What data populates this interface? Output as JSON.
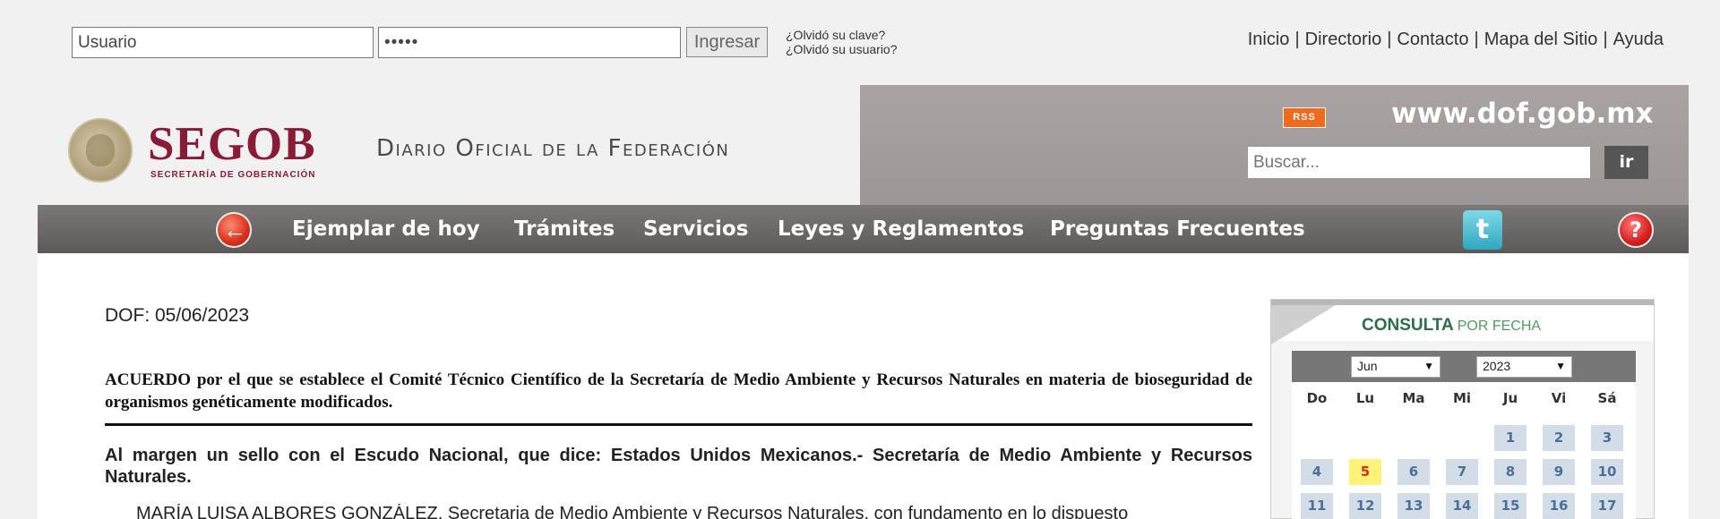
{
  "login": {
    "user_value": "Usuario",
    "password_value": "•••••",
    "submit_label": "Ingresar",
    "forgot_password": "¿Olvidó su clave?",
    "forgot_user": "¿Olvidó su usuario?"
  },
  "topnav": {
    "items": [
      "Inicio",
      "Directorio",
      "Contacto",
      "Mapa del Sitio",
      "Ayuda"
    ],
    "separator": "|"
  },
  "header": {
    "brand": "SEGOB",
    "brand_sub": "SECRETARÍA DE GOBERNACIÓN",
    "title": "Diario Oficial de la Federación",
    "rss_label": "RSS",
    "site_url": "www.dof.gob.mx",
    "search_placeholder": "Buscar...",
    "search_button": "ir"
  },
  "nav": {
    "items": [
      "Ejemplar de hoy",
      "Trámites",
      "Servicios",
      "Leyes y Reglamentos",
      "Preguntas Frecuentes"
    ],
    "back_glyph": "←",
    "twitter_glyph": "t",
    "help_glyph": "?"
  },
  "article": {
    "dof_date": "DOF: 05/06/2023",
    "acuerdo": "ACUERDO por el que se establece el Comité Técnico Científico de la Secretaría de Medio Ambiente y Recursos Naturales en materia de bioseguridad de organismos genéticamente modificados.",
    "margen": "Al margen un sello con el Escudo Nacional, que dice: Estados Unidos Mexicanos.- Secretaría de Medio Ambiente y Recursos Naturales.",
    "paragraph": "MARÍA LUISA ALBORES GONZÁLEZ, Secretaria de Medio Ambiente y Recursos Naturales, con fundamento en lo dispuesto"
  },
  "calendar": {
    "title": "CONSULTA",
    "title_suffix": "POR FECHA",
    "month": "Jun",
    "year": "2023",
    "weekdays": [
      "Do",
      "Lu",
      "Ma",
      "Mi",
      "Ju",
      "Vi",
      "Sá"
    ],
    "first_weekday_index": 4,
    "days": [
      "1",
      "2",
      "3",
      "4",
      "5",
      "6",
      "7",
      "8",
      "9",
      "10",
      "11",
      "12",
      "13",
      "14",
      "15",
      "16",
      "17"
    ],
    "today": "5"
  }
}
